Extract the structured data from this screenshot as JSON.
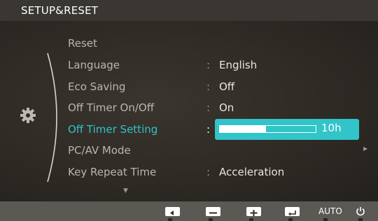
{
  "title": "SETUP&RESET",
  "menu": {
    "items": [
      {
        "label": "Reset",
        "value": ""
      },
      {
        "label": "Language",
        "value": "English"
      },
      {
        "label": "Eco Saving",
        "value": "Off"
      },
      {
        "label": "Off Timer On/Off",
        "value": "On"
      },
      {
        "label": "Off Timer Setting",
        "value": ""
      },
      {
        "label": "PC/AV Mode",
        "value": ""
      },
      {
        "label": "Key Repeat Time",
        "value": "Acceleration"
      }
    ],
    "colon": ":"
  },
  "slider": {
    "value_label": "10h",
    "fill_fraction": 0.48
  },
  "buttons": {
    "left_icon": "left-arrow-icon",
    "minus_icon": "minus-icon",
    "plus_icon": "plus-icon",
    "enter_icon": "enter-icon",
    "auto_label": "AUTO",
    "power_icon": "power-icon"
  },
  "colors": {
    "accent": "#2fc3c8",
    "background": "#2e2a25",
    "bottom_bar": "#5b5954"
  }
}
